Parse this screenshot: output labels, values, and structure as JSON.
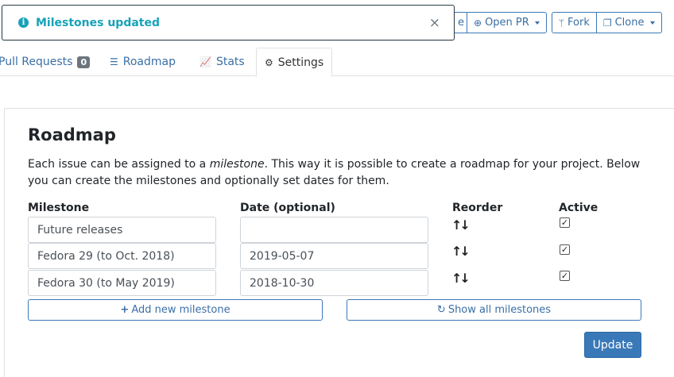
{
  "toast": {
    "message": "Milestones updated",
    "close_glyph": "×"
  },
  "top_actions": {
    "partial_label": "e",
    "open_pr": "Open PR",
    "fork": "Fork",
    "clone": "Clone"
  },
  "tabs": [
    {
      "label": "Pull Requests",
      "badge": "0",
      "icon": "pull-request-icon"
    },
    {
      "label": "Roadmap",
      "icon": "signpost-icon"
    },
    {
      "label": "Stats",
      "icon": "chart-icon"
    },
    {
      "label": "Settings",
      "icon": "gears-icon",
      "active": true
    }
  ],
  "roadmap": {
    "title": "Roadmap",
    "desc_before": "Each issue can be assigned to a ",
    "desc_em": "milestone",
    "desc_after": ". This way it is possible to create a roadmap for your project. Below you can create the milestones and optionally set dates for them.",
    "columns": {
      "milestone": "Milestone",
      "date": "Date (optional)",
      "reorder": "Reorder",
      "active": "Active"
    },
    "rows": [
      {
        "milestone": "Future releases",
        "date": "",
        "active": true
      },
      {
        "milestone": "Fedora 29 (to Oct. 2018)",
        "date": "2019-05-07",
        "active": true
      },
      {
        "milestone": "Fedora 30 (to May 2019)",
        "date": "2018-10-30",
        "active": true
      }
    ],
    "reorder_glyph": "↑↓",
    "add_button": "Add new milestone",
    "show_all_button": "Show all milestones",
    "update_button": "Update"
  }
}
